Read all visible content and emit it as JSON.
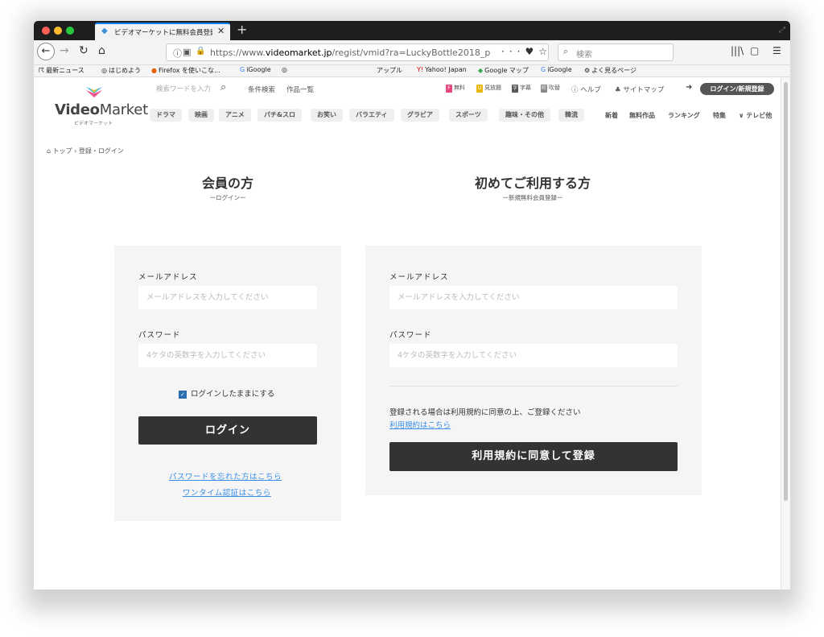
{
  "browser": {
    "tab_title": "ビデオマーケットに無料会員登録",
    "url_prefix": "https://www.",
    "url_domain": "videomarket.jp",
    "url_path": "/regist/vmid?ra=LuckyBottle2018_p",
    "search_placeholder": "検索",
    "bookmarks": [
      "最新ニュース",
      "はじめよう",
      "Firefox を使いこな...",
      "iGoogle",
      "アップル",
      "Yahoo! Japan",
      "Google マップ",
      "iGoogle",
      "よく見るページ"
    ]
  },
  "site": {
    "logo_bold": "Video",
    "logo_light": "Market",
    "logo_sub": "ビデオマーケット",
    "search_placeholder": "検索ワードを入力",
    "header_links": [
      "条件検索",
      "作品一覧"
    ],
    "badges": [
      {
        "icon": "F",
        "label": "無料",
        "color": "#e8457c"
      },
      {
        "icon": "U",
        "label": "見放題",
        "color": "#e9b60d"
      },
      {
        "icon": "字",
        "label": "字幕",
        "color": "#555555"
      },
      {
        "icon": "吹",
        "label": "吹替",
        "color": "#888888"
      }
    ],
    "help_label": "ヘルプ",
    "sitemap_label": "サイトマップ",
    "login_register": "ログイン/新規登録",
    "categories": [
      "ドラマ",
      "映画",
      "アニメ",
      "パチ&スロ",
      "お笑い",
      "バラエティ",
      "グラビア",
      "スポーツ",
      "趣味・その他",
      "韓流"
    ],
    "right_links": [
      "新着",
      "無料作品",
      "ランキング",
      "特集",
      "テレビ他"
    ]
  },
  "breadcrumb": {
    "home": "トップ",
    "current": "登録・ログイン"
  },
  "member": {
    "title": "会員の方",
    "subtitle": "ーログインー",
    "email_label": "メールアドレス",
    "email_placeholder": "メールアドレスを入力してください",
    "password_label": "パスワード",
    "password_placeholder": "4ケタの英数字を入力してください",
    "remember_label": "ログインしたままにする",
    "login_button": "ログイン",
    "forgot_link": "パスワードを忘れた方はこちら",
    "onetime_link": "ワンタイム認証はこちら"
  },
  "newuser": {
    "title": "初めてご利用する方",
    "subtitle": "ー新規無料会員登録ー",
    "email_label": "メールアドレス",
    "email_placeholder": "メールアドレスを入力してください",
    "password_label": "パスワード",
    "password_placeholder": "4ケタの英数字を入力してください",
    "terms_notice": "登録される場合は利用規約に同意の上、ご登録ください",
    "terms_link": "利用規約はこちら",
    "register_button": "利用規約に同意して登録"
  }
}
